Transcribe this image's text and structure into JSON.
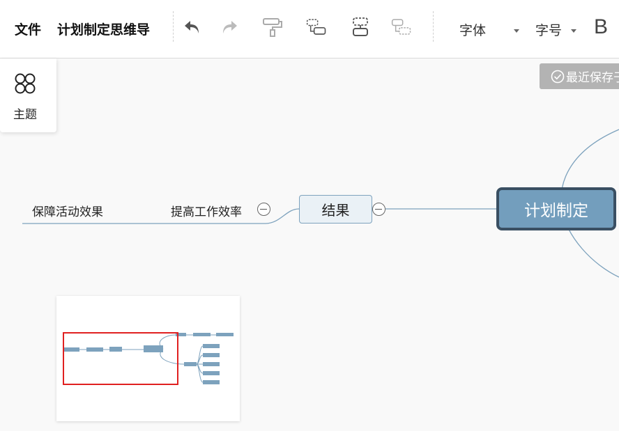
{
  "toolbar": {
    "file_label": "文件",
    "doc_title": "计划制定思维导",
    "font_label": "字体",
    "size_label": "字号",
    "bold_label": "B",
    "icons": [
      "undo-icon",
      "redo-icon",
      "format-painter-icon",
      "insert-child-node-icon",
      "insert-sibling-node-icon",
      "insert-parent-node-icon"
    ]
  },
  "theme_panel": {
    "label": "主题",
    "icon": "theme-icon"
  },
  "save_status": {
    "label": "最近保存于",
    "icon": "check-circle-icon"
  },
  "mindmap": {
    "root": "计划制定",
    "branch": "结果",
    "child": "提高工作效率",
    "grandchild": "保障活动效果"
  },
  "colors": {
    "root_fill": "#739ebd",
    "root_border": "#3a4f62",
    "branch_fill": "#eaf1f6",
    "line": "#7da2bd",
    "minimap_viewport": "#e02020"
  }
}
